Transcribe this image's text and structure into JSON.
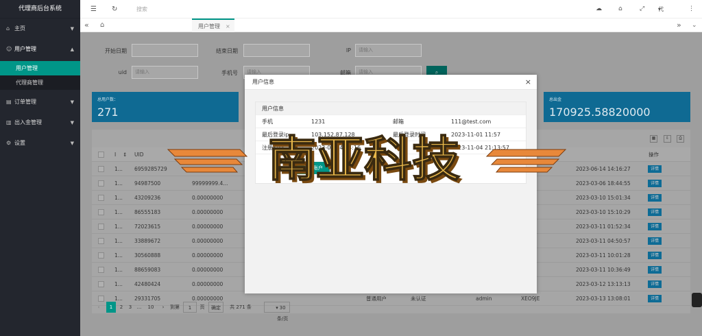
{
  "app": {
    "title": "代理商后台系统"
  },
  "sidebar": {
    "items": [
      {
        "label": "主页"
      },
      {
        "label": "用户管理"
      },
      {
        "label": "订单管理"
      },
      {
        "label": "出入金管理"
      },
      {
        "label": "设置"
      }
    ],
    "sub": [
      {
        "label": "用户管理"
      },
      {
        "label": "代理商管理"
      }
    ]
  },
  "topbar": {
    "search": "搜索",
    "user": "代理商"
  },
  "tabs": {
    "active": "用户管理",
    "close": "×"
  },
  "filters": {
    "start_date": "开始日期",
    "end_date": "结束日期",
    "ip": "IP",
    "ip_ph": "请输入",
    "uid": "uid",
    "uid_ph": "请输入",
    "phone": "手机号",
    "phone_ph": "请输入",
    "email": "邮箱",
    "email_ph": "请输入"
  },
  "stats": [
    {
      "title": "总用户数：",
      "value": "271"
    },
    {
      "title": "总出金",
      "value": "170925.58820000"
    }
  ],
  "table": {
    "headers": {
      "uid": "UID",
      "op": "操作"
    },
    "rows": [
      {
        "id": "1...",
        "uid": "6959285729",
        "bal": "",
        "time": "2023-06-14 14:16:27"
      },
      {
        "id": "1...",
        "uid": "94987500",
        "bal": "99999999.4...",
        "time": "2023-03-06 18:44:55"
      },
      {
        "id": "1...",
        "uid": "43209236",
        "bal": "0.00000000",
        "time": "2023-03-10 15:01:34"
      },
      {
        "id": "1...",
        "uid": "86555183",
        "bal": "0.00000000",
        "time": "2023-03-10 15:10:29"
      },
      {
        "id": "1...",
        "uid": "72023615",
        "bal": "0.00000000",
        "time": "2023-03-11 01:52:34"
      },
      {
        "id": "1...",
        "uid": "33889672",
        "bal": "0.00000000",
        "time": "2023-03-11 04:50:57"
      },
      {
        "id": "1...",
        "uid": "30560888",
        "bal": "0.00000000",
        "time": "2023-03-11 10:01:28"
      },
      {
        "id": "1...",
        "uid": "88659083",
        "bal": "0.00000000",
        "time": "2023-03-11 10:36:49"
      },
      {
        "id": "1...",
        "uid": "42480424",
        "bal": "0.00000000",
        "time": "2023-03-12 13:13:13"
      },
      {
        "id": "1...",
        "uid": "29331705",
        "bal": "0.00000000",
        "time": "2023-03-13 13:08:01",
        "type": "普通用户",
        "auth": "未认证",
        "agent": "admin",
        "code": "XEO9JE"
      }
    ],
    "detail_label": "详情"
  },
  "pager": {
    "pages": [
      "1",
      "2",
      "3",
      "...",
      "10"
    ],
    "goto": "到第",
    "page_val": "1",
    "page_unit": "页",
    "confirm": "确定",
    "total": "共 271 条",
    "size": "30 条/页"
  },
  "modal": {
    "title": "用户信息",
    "section": "用户信息",
    "phone_label": "手机",
    "phone": "1231",
    "email_label": "邮箱",
    "email": "111@test.com",
    "ip_label": "最后登录ip",
    "ip": "103.152.87.128",
    "ip_time_label": "最后登录时间",
    "ip_time": "2023-11-01 11:57",
    "reg_label": "注册时间",
    "reg": "2023-06-14 14:16",
    "time2": "2023-11-04 21:13:57",
    "btn": "登录账户"
  },
  "watermark": "南亚科技"
}
